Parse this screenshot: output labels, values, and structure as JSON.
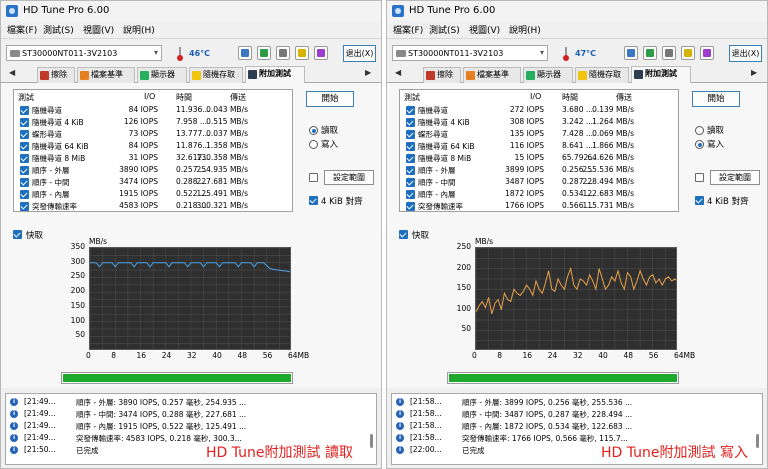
{
  "colors": {
    "accent": "#1f6fbf",
    "chart_bg": "#2f2f2f",
    "chart_line_read": "#4aa3e8",
    "chart_line_write": "#e8a14a",
    "progress": "#1fa82e",
    "caption": "#e0211e"
  },
  "windows": [
    {
      "title": "HD Tune Pro 6.00",
      "menu": [
        "檔案(F)",
        "測試(S)",
        "視圖(V)",
        "說明(H)"
      ],
      "drive": "ST30000NT011-3V2103",
      "temperature": "46°C",
      "exit_label": "退出(X)",
      "tabs": [
        "擦除",
        "檔案基準",
        "顯示器",
        "隨機存取",
        "附加測試"
      ],
      "results_header": {
        "test": "測試",
        "io": "I/O",
        "time": "時間",
        "speed": "傳送"
      },
      "results": [
        {
          "test": "隨機尋道",
          "io": "84 IOPS",
          "time": "11.936...",
          "speed": "0.043 MB/s"
        },
        {
          "test": "隨機尋道 4 KiB",
          "io": "126 IOPS",
          "time": "7.958 ...",
          "speed": "0.515 MB/s"
        },
        {
          "test": "蝶形尋道",
          "io": "73 IOPS",
          "time": "13.777...",
          "speed": "0.037 MB/s"
        },
        {
          "test": "隨機尋道 64 KiB",
          "io": "84 IOPS",
          "time": "11.876...",
          "speed": "1.358 MB/s"
        },
        {
          "test": "隨機尋道 8 MiB",
          "io": "31 IOPS",
          "time": "32.617...",
          "speed": "130.358 MB/s"
        },
        {
          "test": "順序 - 外層",
          "io": "3890 IOPS",
          "time": "0.257 ...",
          "speed": "254.935 MB/s"
        },
        {
          "test": "順序 - 中間",
          "io": "3474 IOPS",
          "time": "0.288 ...",
          "speed": "227.681 MB/s"
        },
        {
          "test": "順序 - 內層",
          "io": "1915 IOPS",
          "time": "0.522 ...",
          "speed": "125.491 MB/s"
        },
        {
          "test": "突發傳輸速率",
          "io": "4583 IOPS",
          "time": "0.218 ...",
          "speed": "300.321 MB/s"
        }
      ],
      "start_label": "開始",
      "radio_read": "讀取",
      "radio_write": "寫入",
      "mode": "read",
      "range_label": "設定範圍",
      "align_label": "4 KiB 對齊",
      "fast_label": "快取",
      "log": [
        {
          "time": "[21:49...",
          "msg": "順序 - 外層: 3890 IOPS, 0.257 毫秒, 254.935 ..."
        },
        {
          "time": "[21:49...",
          "msg": "順序 - 中間: 3474 IOPS, 0.288 毫秒, 227.681 ..."
        },
        {
          "time": "[21:49...",
          "msg": "順序 - 內層: 1915 IOPS, 0.522 毫秒, 125.491 ..."
        },
        {
          "time": "[21:49...",
          "msg": "突發傳輸速率: 4583 IOPS, 0.218 毫秒, 300.3..."
        },
        {
          "time": "[21:50...",
          "msg": "已完成"
        }
      ],
      "caption": "HD Tune附加測試 讀取",
      "progress": 1.0
    },
    {
      "title": "HD Tune Pro 6.00",
      "menu": [
        "檔案(F)",
        "測試(S)",
        "視圖(V)",
        "說明(H)"
      ],
      "drive": "ST30000NT011-3V2103",
      "temperature": "47°C",
      "exit_label": "退出(X)",
      "tabs": [
        "擦除",
        "檔案基準",
        "顯示器",
        "隨機存取",
        "附加測試"
      ],
      "results_header": {
        "test": "測試",
        "io": "I/O",
        "time": "時間",
        "speed": "傳送"
      },
      "results": [
        {
          "test": "隨機尋道",
          "io": "272 IOPS",
          "time": "3.680 ...",
          "speed": "0.139 MB/s"
        },
        {
          "test": "隨機尋道 4 KiB",
          "io": "308 IOPS",
          "time": "3.242 ...",
          "speed": "1.264 MB/s"
        },
        {
          "test": "蝶形尋道",
          "io": "135 IOPS",
          "time": "7.428 ...",
          "speed": "0.069 MB/s"
        },
        {
          "test": "隨機尋道 64 KiB",
          "io": "116 IOPS",
          "time": "8.641 ...",
          "speed": "1.866 MB/s"
        },
        {
          "test": "隨機尋道 8 MiB",
          "io": "15 IOPS",
          "time": "65.792...",
          "speed": "64.626 MB/s"
        },
        {
          "test": "順序 - 外層",
          "io": "3899 IOPS",
          "time": "0.256 ...",
          "speed": "255.536 MB/s"
        },
        {
          "test": "順序 - 中間",
          "io": "3487 IOPS",
          "time": "0.287 ...",
          "speed": "228.494 MB/s"
        },
        {
          "test": "順序 - 內層",
          "io": "1872 IOPS",
          "time": "0.534 ...",
          "speed": "122.683 MB/s"
        },
        {
          "test": "突發傳輸速率",
          "io": "1766 IOPS",
          "time": "0.566 ...",
          "speed": "115.731 MB/s"
        }
      ],
      "start_label": "開始",
      "radio_read": "讀取",
      "radio_write": "寫入",
      "mode": "write",
      "range_label": "設定範圍",
      "align_label": "4 KiB 對齊",
      "fast_label": "快取",
      "log": [
        {
          "time": "[21:58...",
          "msg": "順序 - 外層: 3899 IOPS, 0.256 毫秒, 255.536 ..."
        },
        {
          "time": "[21:58...",
          "msg": "順序 - 中間: 3487 IOPS, 0.287 毫秒, 228.494 ..."
        },
        {
          "time": "[21:58...",
          "msg": "順序 - 內層: 1872 IOPS, 0.534 毫秒, 122.683 ..."
        },
        {
          "time": "[21:58...",
          "msg": "突發傳輸速率: 1766 IOPS, 0.566 毫秒, 115.7..."
        },
        {
          "time": "[22:00...",
          "msg": "已完成"
        }
      ],
      "caption": "HD Tune附加測試 寫入",
      "progress": 1.0
    }
  ],
  "chart_data": [
    {
      "type": "line",
      "ylabel": "MB/s",
      "ylim": [
        0,
        350
      ],
      "yticks": [
        50,
        100,
        150,
        200,
        250,
        300,
        350
      ],
      "xlim": [
        0,
        64
      ],
      "xticks": [
        "0",
        "8",
        "16",
        "24",
        "32",
        "40",
        "48",
        "56",
        "64MB"
      ],
      "series": [
        {
          "values": [
            300,
            300,
            300,
            286,
            300,
            300,
            300,
            300,
            286,
            300,
            300,
            300,
            300,
            300,
            286,
            300,
            300,
            300,
            300,
            286,
            300,
            300,
            300,
            300,
            300,
            286,
            300,
            300,
            300,
            300,
            300,
            286,
            300,
            300,
            300,
            300,
            286,
            300,
            300,
            300,
            300,
            286,
            300,
            300,
            300,
            300,
            300,
            286,
            300,
            300,
            300,
            300,
            286,
            300,
            300,
            300,
            290,
            280,
            278,
            276,
            275,
            273,
            272,
            270,
            268
          ]
        }
      ],
      "grid": true
    },
    {
      "type": "line",
      "ylabel": "MB/s",
      "ylim": [
        0,
        250
      ],
      "yticks": [
        50,
        100,
        150,
        200,
        250
      ],
      "xlim": [
        0,
        64
      ],
      "xticks": [
        "0",
        "8",
        "16",
        "24",
        "32",
        "40",
        "48",
        "56",
        "64MB"
      ],
      "series": [
        {
          "values": [
            95,
            110,
            120,
            105,
            130,
            90,
            115,
            125,
            100,
            140,
            125,
            120,
            150,
            140,
            135,
            145,
            160,
            150,
            135,
            170,
            150,
            140,
            165,
            195,
            150,
            145,
            175,
            160,
            150,
            180,
            200,
            160,
            150,
            175,
            170,
            160,
            185,
            170,
            150,
            200,
            175,
            150,
            160,
            180,
            170,
            195,
            165,
            150,
            190,
            180,
            150,
            170,
            195,
            175,
            160,
            180,
            185,
            165,
            175,
            160,
            175,
            180,
            170,
            175,
            168
          ]
        }
      ],
      "grid": true
    }
  ]
}
